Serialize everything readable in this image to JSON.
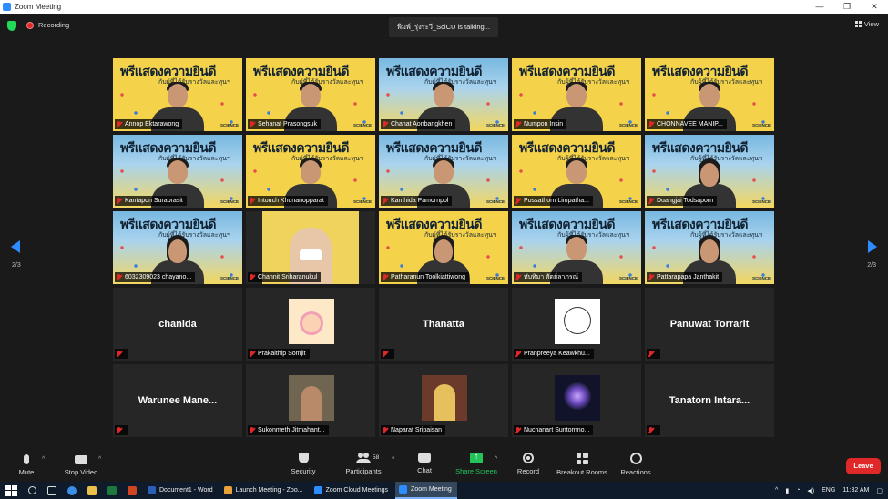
{
  "window": {
    "title": "Zoom Meeting",
    "controls": [
      "—",
      "❐",
      "✕"
    ]
  },
  "status": {
    "recording_label": "Recording",
    "talking_text": "พิมพ์_รุ่งระวี_SciCU is talking...",
    "view_label": "View",
    "page_left": "2/3",
    "page_right": "2/3"
  },
  "banner": {
    "line1": "พรีแสดงความยินดี",
    "line2": "กับผู้ที่ได้รับรางวัลและทุนฯ",
    "logo": "SCIENCE"
  },
  "participants": [
    {
      "name": "Annop Ektarawong"
    },
    {
      "name": "Sehanat Prasongsuk"
    },
    {
      "name": "Chanat Aonbangkhen"
    },
    {
      "name": "Numpon Insin"
    },
    {
      "name": "CHONNAVEE MANIP..."
    },
    {
      "name": "Kantapon Suraprasit"
    },
    {
      "name": "Intouch Khunanopparat"
    },
    {
      "name": "Kanthida Pamornpol"
    },
    {
      "name": "Possathorn Limpatha..."
    },
    {
      "name": "Duangjai Todsaporn"
    },
    {
      "name": "6032309023 chayano..."
    },
    {
      "name": "Channit Sriharanukul"
    },
    {
      "name": "Patharanun Toolkiattiwong"
    },
    {
      "name": "ทับทิมา สัตย์ลาภรณ์"
    },
    {
      "name": "Pattarapapa Janthakit"
    },
    {
      "name": "chanida",
      "display": "chanida"
    },
    {
      "name": "Prakaithip Somjit"
    },
    {
      "name": "Thanatta",
      "display": "Thanatta"
    },
    {
      "name": "Pranpreeya Keawkhu..."
    },
    {
      "name": "Panuwat Torrarit",
      "display": "Panuwat Torrarit"
    },
    {
      "name": "Warunee Mane...",
      "display": "Warunee  Mane..."
    },
    {
      "name": "Sukonmeth Jitmahant..."
    },
    {
      "name": "Naparat Sripaisan"
    },
    {
      "name": "Nuchanart Suntornno..."
    },
    {
      "name": "Tanatorn Intara...",
      "display": "Tanatorn  Intara..."
    }
  ],
  "controls": {
    "mute": "Mute",
    "stop_video": "Stop Video",
    "security": "Security",
    "participants": "Participants",
    "participants_count": "58",
    "chat": "Chat",
    "share_screen": "Share Screen",
    "record": "Record",
    "breakout_rooms": "Breakout Rooms",
    "reactions": "Reactions",
    "leave": "Leave"
  },
  "taskbar": {
    "apps": [
      {
        "label": "Document1 - Word",
        "color": "#2b5eb5"
      },
      {
        "label": "Launch Meeting - Zoo...",
        "color": "#e8a23a"
      },
      {
        "label": "Zoom Cloud Meetings",
        "color": "#2d8cff"
      },
      {
        "label": "Zoom Meeting",
        "color": "#2d8cff"
      }
    ],
    "lang": "ENG",
    "time": "11:32 AM"
  },
  "colors": {
    "accent": "#2d8cff",
    "leave": "#e02828",
    "share": "#23c35a"
  }
}
